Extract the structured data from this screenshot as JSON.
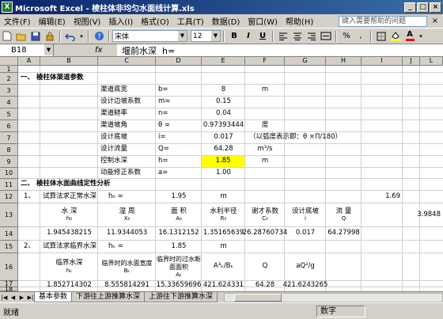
{
  "window": {
    "app_icon": "X",
    "title": "Microsoft Excel - 棱柱体非均匀水面线计算.xls"
  },
  "menu": {
    "items": [
      "文件(F)",
      "编辑(E)",
      "视图(V)",
      "插入(I)",
      "格式(O)",
      "工具(T)",
      "数据(D)",
      "窗口(W)",
      "帮助(H)"
    ],
    "help_placeholder": "键入需要帮助的问题",
    "close_glyph": "×"
  },
  "toolbar": {
    "font_name": "宋体",
    "font_size": "12",
    "bold": "B",
    "italic": "I",
    "underline": "U",
    "percent": "%",
    "comma": ",",
    "font_color_a": "A"
  },
  "formula_bar": {
    "name_box": "B18",
    "fx": "fx",
    "content": "堰前水深  h="
  },
  "columns": [
    "A",
    "B",
    "C",
    "D",
    "E",
    "F",
    "G",
    "H",
    "I",
    "J",
    "L"
  ],
  "rows": [
    "1",
    "2",
    "3",
    "4",
    "5",
    "6",
    "7",
    "8",
    "9",
    "10",
    "11",
    "12",
    "13",
    "14",
    "15",
    "16",
    "17",
    "18"
  ],
  "sheet": {
    "sec1_title": "一、   棱柱体渠道参数",
    "params": [
      {
        "label": "渠道底宽",
        "sym": "b=",
        "val": "8",
        "unit": "m"
      },
      {
        "label": "设计边坡系数",
        "sym": "m=",
        "val": "0.15",
        "unit": ""
      },
      {
        "label": "渠道糙率",
        "sym": "n=",
        "val": "0.04",
        "unit": ""
      },
      {
        "label": "渠道坡角",
        "sym": "θ =",
        "val": "0.97393444",
        "unit": "度"
      },
      {
        "label": "设计底坡",
        "sym": "i=",
        "val": "0.017",
        "unit": "（以弧度表示即：θ ×Π/180）"
      },
      {
        "label": "设计流量",
        "sym": "Q=",
        "val": "64.28",
        "unit": "m³/s"
      },
      {
        "label": "控制水深",
        "sym": "h=",
        "val": "1.85",
        "unit": "m"
      },
      {
        "label": "动能修正系数",
        "sym": "a=",
        "val": "1.00",
        "unit": ""
      }
    ],
    "sec2_title": "二、  棱柱体水面曲线定性分析",
    "r12": {
      "num": "1、",
      "label": "试算法求正常水深",
      "sym": "h₀ =",
      "val": "1.95",
      "unit": "m",
      "extra": "1.69"
    },
    "r13_headers": [
      {
        "top": "水 深",
        "bot": "h₀"
      },
      {
        "top": "湿 周",
        "bot": "X₀"
      },
      {
        "top": "面 积",
        "bot": "A₀"
      },
      {
        "top": "水利半径",
        "bot": "R₀"
      },
      {
        "top": "谢才系数",
        "bot": "C₀"
      },
      {
        "top": "设计底坡",
        "bot": "i"
      },
      {
        "top": "流 量",
        "bot": "Q"
      }
    ],
    "r13_extra": "3.9848",
    "r14": [
      "1.945438215",
      "11.9344053",
      "16.1312152",
      "1.35165639",
      "26.28760734",
      "0.017",
      "64.27998"
    ],
    "r15": {
      "num": "2、",
      "label": "试算法求临界水深",
      "sym": "hₖ =",
      "val": "1.85",
      "unit": "m"
    },
    "r16_headers": [
      {
        "top": "临界水深",
        "bot": "hₖ"
      },
      {
        "top": "临界时的水面宽度",
        "bot": "Bₖ"
      },
      {
        "top": "临界时的过水断面面积",
        "bot": "Aₖ"
      },
      {
        "top": "A³ₖ/Bₖ",
        "bot": ""
      },
      {
        "top": "Q",
        "bot": ""
      },
      {
        "top": "aQ²/g",
        "bot": ""
      }
    ],
    "r17": [
      "1.852714302",
      "8.555814291",
      "15.33659696",
      "421.624331",
      "64.28",
      "421.6243265"
    ]
  },
  "tabs": [
    "基本参数",
    "下游往上游推算水深",
    "上游往下游推算水深"
  ],
  "status": {
    "ready": "就绪",
    "mode": "数字"
  }
}
